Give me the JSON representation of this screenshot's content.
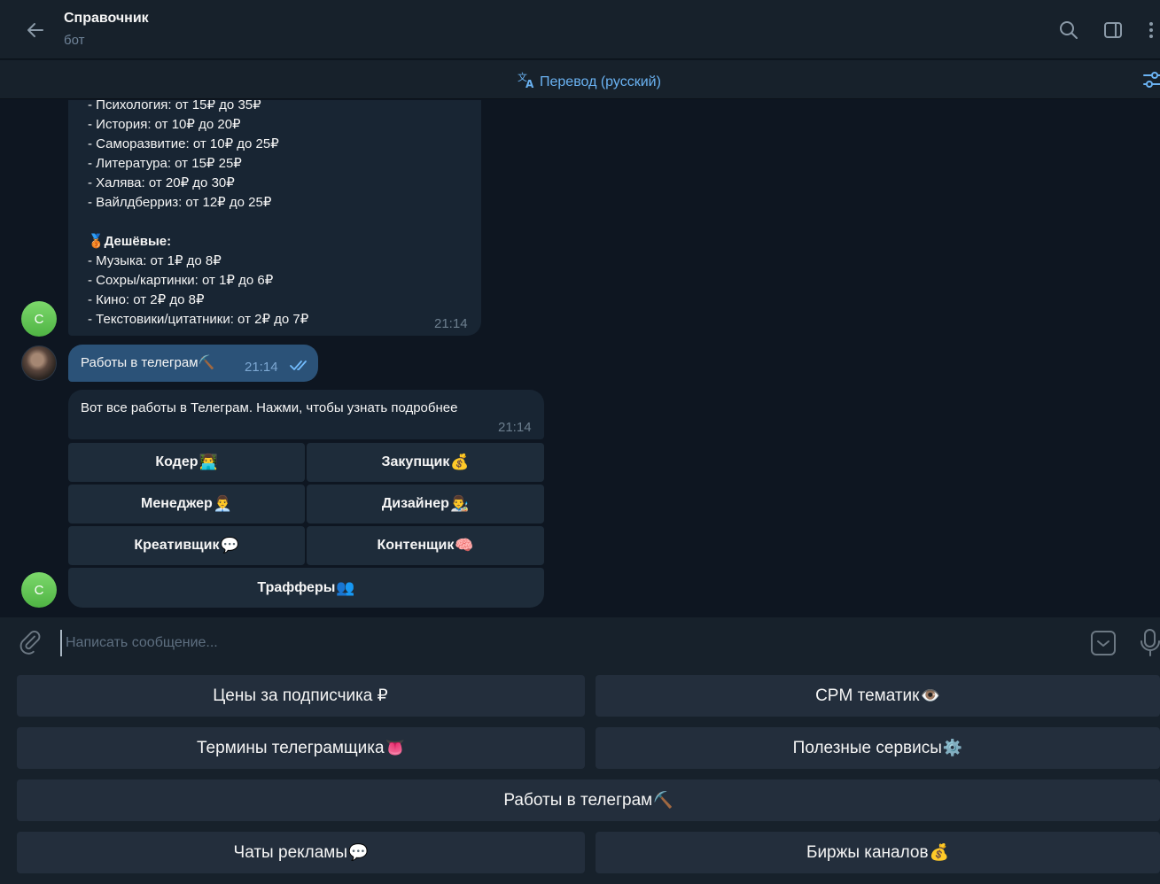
{
  "header": {
    "title": "Справочник",
    "subtitle": "бот",
    "icons": [
      "back-arrow-icon",
      "search-icon",
      "sidebar-panel-icon",
      "more-vertical-icon"
    ]
  },
  "translate_bar": {
    "label": "Перевод (русский)",
    "icon": "translate-icon"
  },
  "messages": [
    {
      "lines": [
        "- Психология: от 15₽ до 35₽",
        "- История: от 10₽ до 20₽",
        "- Саморазвитие: от 10₽ до 25₽",
        "- Литература: от 15₽ 25₽",
        "- Халява: от 20₽ до 30₽",
        "- Вайлдберриз: от 12₽ до 25₽",
        "",
        "🥉Дешёвые:",
        "- Музыка: от 1₽ до 8₽",
        "- Сохры/картинки: от 1₽ до 6₽",
        "- Кино: от 2₽ до 8₽",
        "- Текстовики/цитатники: от 2₽ до 7₽"
      ],
      "time": "21:14",
      "avatar_letter": "С"
    },
    {
      "text": "Работы в телеграм⛏️",
      "time": "21:14"
    },
    {
      "text": "Вот все работы в Телеграм. Нажми, чтобы узнать подробнее",
      "time": "21:14",
      "avatar_letter": "С"
    }
  ],
  "inline_keyboard": [
    {
      "label": "Кодер",
      "emoji": "👨‍💻"
    },
    {
      "label": "Закупщик",
      "emoji": "💰"
    },
    {
      "label": "Менеджер",
      "emoji": "👨‍💼"
    },
    {
      "label": "Дизайнер",
      "emoji": "👨‍🎨"
    },
    {
      "label": "Креативщик",
      "emoji": "💬"
    },
    {
      "label": "Контенщик",
      "emoji": "🧠"
    },
    {
      "label": "Трафферы",
      "emoji": "👥"
    }
  ],
  "composer": {
    "placeholder": "Написать сообщение..."
  },
  "reply_keyboard": [
    {
      "label": "Цены за подписчика ₽",
      "emoji": ""
    },
    {
      "label": "CPM тематик",
      "emoji": "👁️"
    },
    {
      "label": "Термины телеграмщика",
      "emoji": "👅"
    },
    {
      "label": "Полезные сервисы",
      "emoji": "⚙️"
    },
    {
      "label": "Работы в телеграм",
      "emoji": "⛏️"
    },
    {
      "label": "Чаты рекламы",
      "emoji": "💬"
    },
    {
      "label": "Биржы каналов",
      "emoji": "💰"
    }
  ],
  "colors": {
    "background": "#0e1621",
    "panel": "#17212b",
    "bubble_in": "#182533",
    "bubble_out": "#2b5278",
    "accent": "#6ab2f2"
  }
}
